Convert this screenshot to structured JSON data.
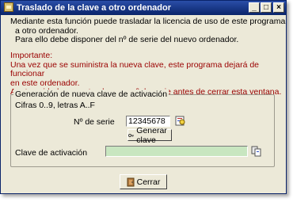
{
  "window": {
    "title": "Traslado de la clave a otro ordenador",
    "controls": {
      "minimize": "_",
      "maximize": "□",
      "close": "×"
    }
  },
  "info": {
    "lines": [
      "Mediante esta función puede trasladar la licencia de uso de este programa",
      "a otro ordenador.",
      "Para ello debe disponer del nº de serie del nuevo ordenador."
    ]
  },
  "warning": {
    "heading": "Importante:",
    "lines": [
      "Una vez que se suministra la nueva clave, este programa dejará de funcionar",
      "en este ordenador.",
      "Anote cuidadosamente el nuevo nº de serie antes de cerrar esta ventana."
    ]
  },
  "group": {
    "legend": "Generación de nueva clave de activación",
    "hint": "Cifras 0..9, letras A..F",
    "serial_label": "Nº de serie",
    "serial_value": "12345678",
    "generate_button": "Generar clave",
    "key_label": "Clave de activación",
    "key_value": ""
  },
  "footer": {
    "close_button": "Cerrar"
  },
  "colors": {
    "title_bar": "#0a246a",
    "warning_text": "#9a0000",
    "key_field_bg": "#c8e6c0",
    "serial_field_bg": "#ffffff"
  },
  "icons": [
    "app-icon",
    "lookup-icon",
    "key-icon",
    "copy-icon",
    "door-icon"
  ]
}
